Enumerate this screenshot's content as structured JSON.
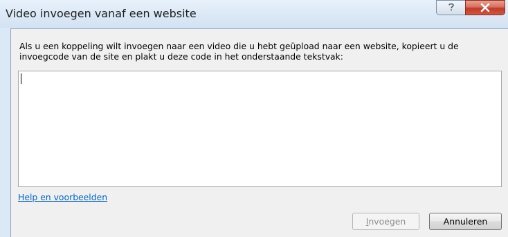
{
  "window": {
    "title": "Video invoegen vanaf een website",
    "help_icon": "question-icon",
    "close_icon": "close-icon"
  },
  "dialog": {
    "instructions": "Als u een koppeling wilt invoegen naar een video die u hebt geüpload naar een website, kopieert u de invoegcode van de site en plakt u deze code in het onderstaande tekstvak:",
    "embed_code_value": "",
    "help_link": "Help en voorbeelden",
    "insert_button": {
      "mnemonic": "I",
      "rest": "nvoegen",
      "enabled": false
    },
    "cancel_button": "Annuleren"
  },
  "colors": {
    "link": "#0066cc",
    "close_button": "#c4372a",
    "frame": "#dbe8f6"
  }
}
